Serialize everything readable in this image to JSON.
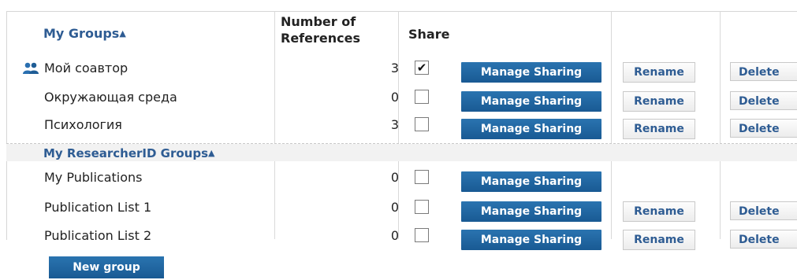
{
  "header": {
    "groups_title": "My Groups",
    "sort_arrow": "▲",
    "references_label_line1": "Number of",
    "references_label_line2": "References",
    "share_label": "Share"
  },
  "my_groups": [
    {
      "name": "Мой соавтор",
      "count": "3",
      "shared": true,
      "icon": "people-icon",
      "manage": "Manage Sharing",
      "rename": "Rename",
      "delete": "Delete"
    },
    {
      "name": "Окружающая среда",
      "count": "0",
      "shared": false,
      "manage": "Manage Sharing",
      "rename": "Rename",
      "delete": "Delete"
    },
    {
      "name": "Психология",
      "count": "3",
      "shared": false,
      "manage": "Manage Sharing",
      "rename": "Rename",
      "delete": "Delete"
    }
  ],
  "researcherid": {
    "title": "My ResearcherID Groups",
    "sort_arrow": "▲",
    "items": [
      {
        "name": "My Publications",
        "count": "0",
        "shared": false,
        "manage": "Manage Sharing"
      },
      {
        "name": "Publication List 1",
        "count": "0",
        "shared": false,
        "manage": "Manage Sharing",
        "rename": "Rename",
        "delete": "Delete"
      },
      {
        "name": "Publication List 2",
        "count": "0",
        "shared": false,
        "manage": "Manage Sharing",
        "rename": "Rename",
        "delete": "Delete"
      }
    ]
  },
  "new_group_label": "New group",
  "checkmark": "✔",
  "colors": {
    "link_blue": "#2e5c93",
    "button_blue": "#1f649f"
  }
}
